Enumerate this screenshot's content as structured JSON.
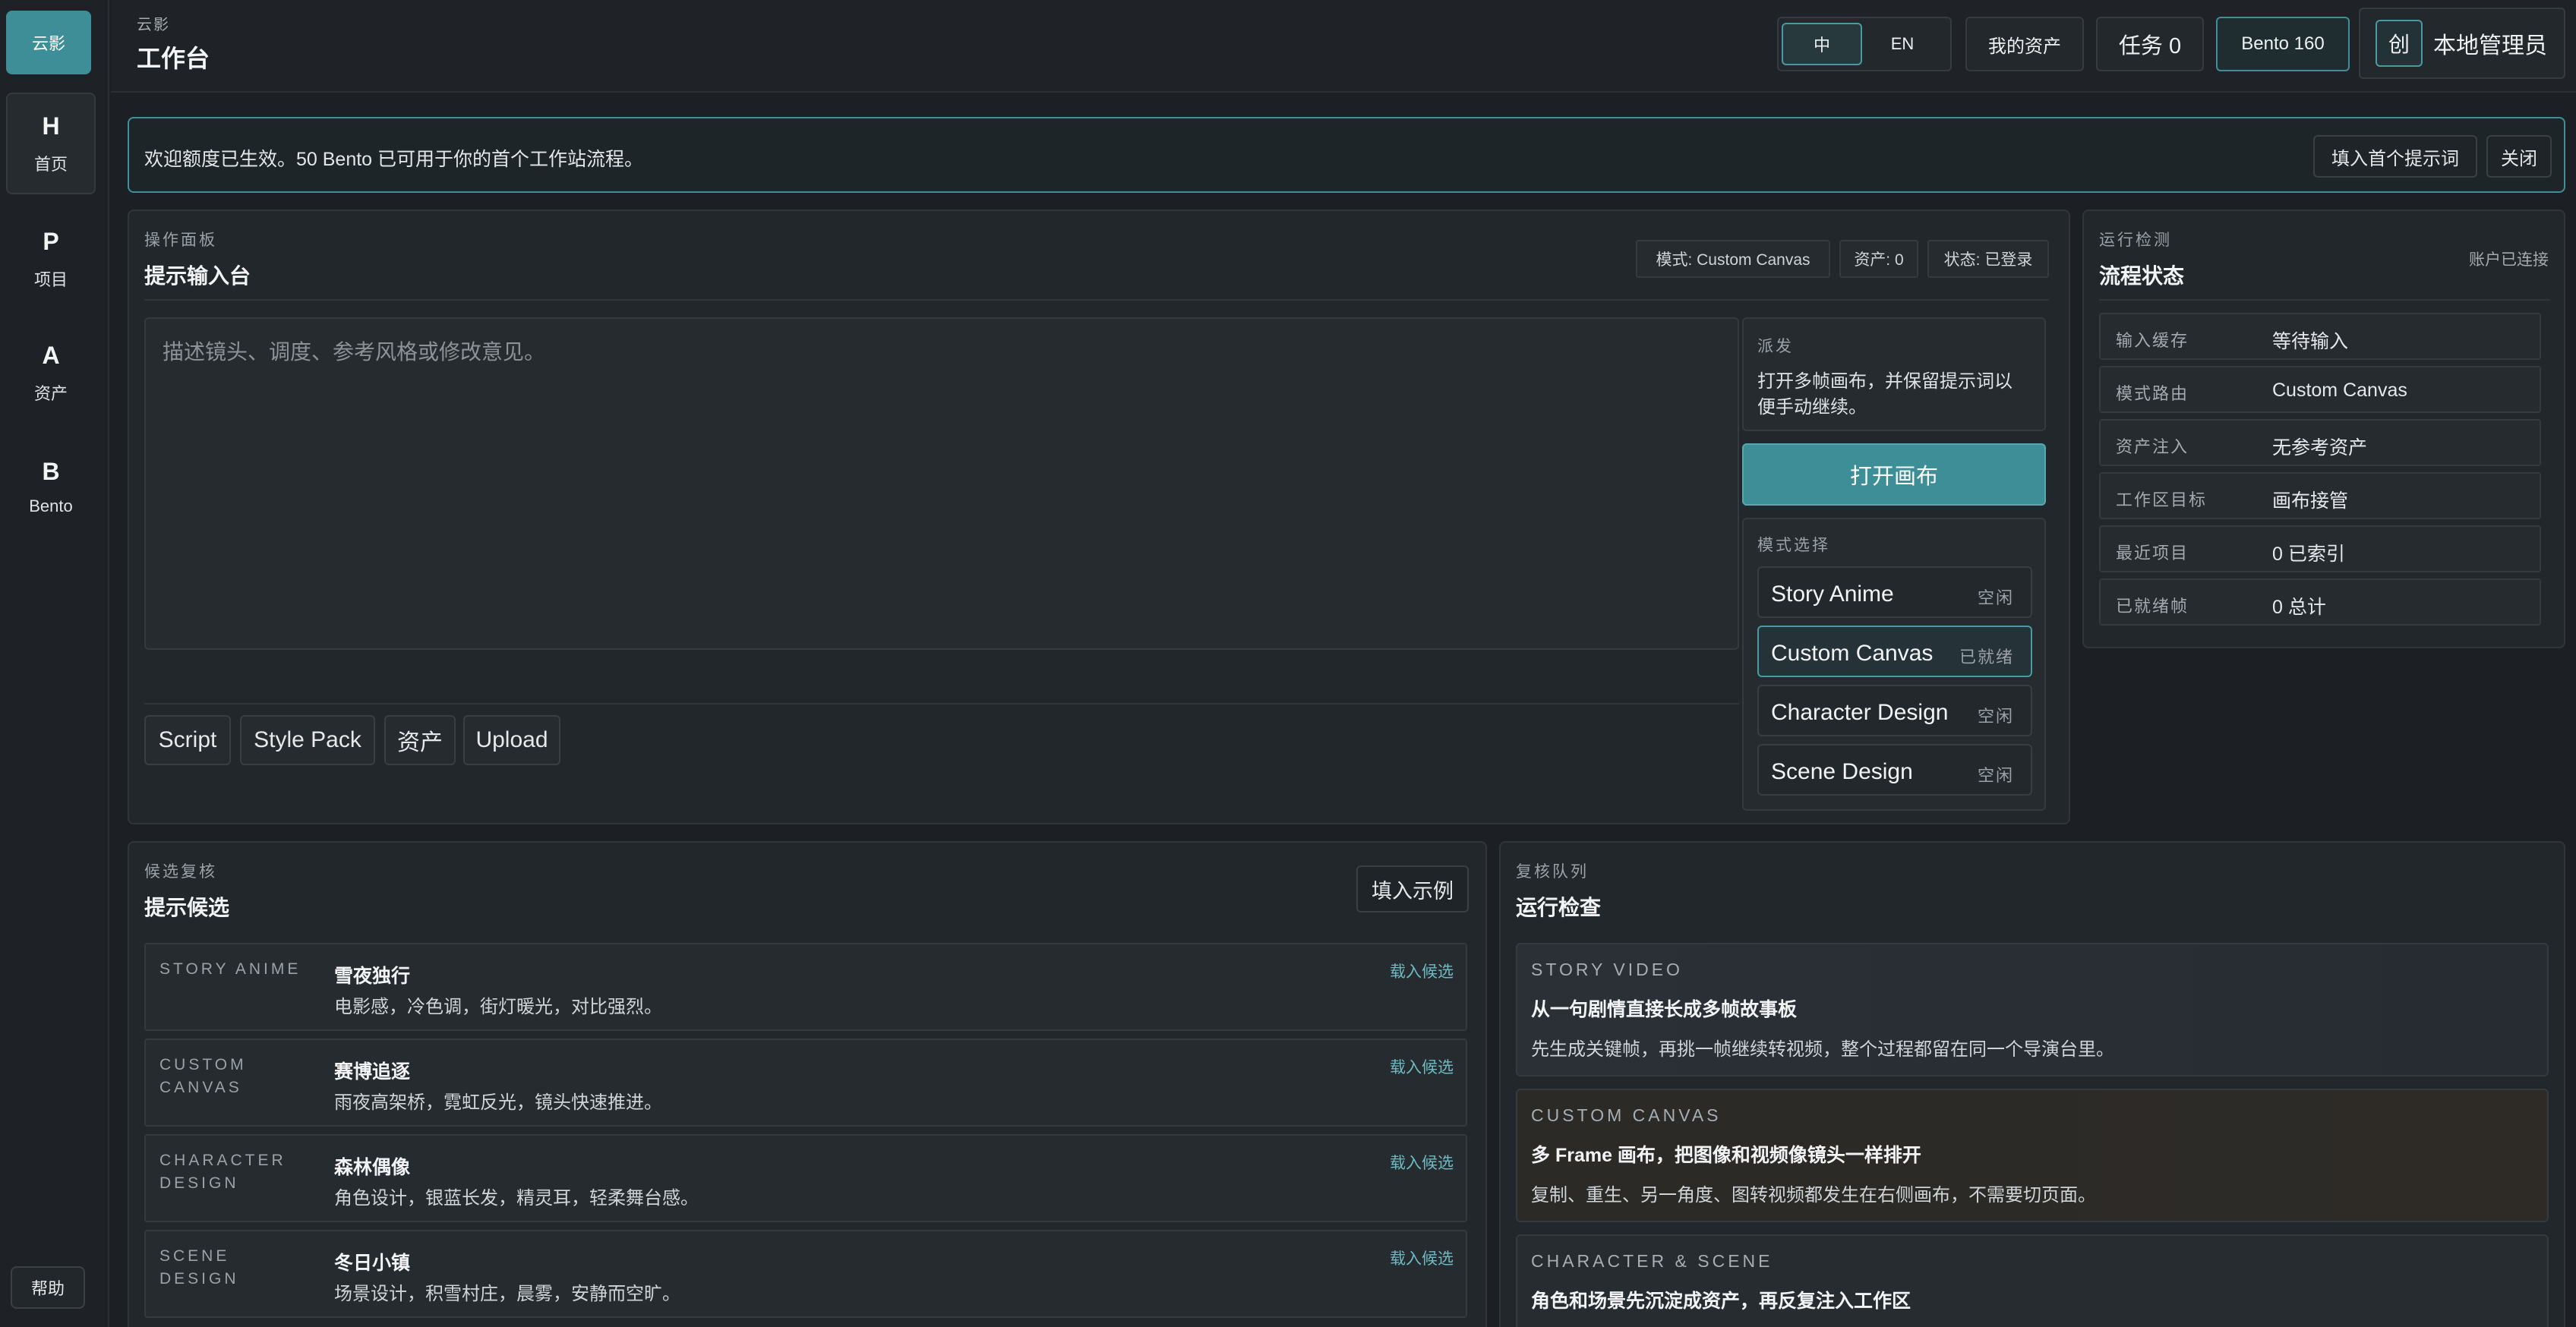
{
  "sidebar": {
    "logo": "云影",
    "items": [
      {
        "letter": "H",
        "label": "首页"
      },
      {
        "letter": "P",
        "label": "项目"
      },
      {
        "letter": "A",
        "label": "资产"
      },
      {
        "letter": "B",
        "label": "Bento"
      }
    ],
    "help": "帮助"
  },
  "header": {
    "brand": "云影",
    "title": "工作台",
    "lang": {
      "zh": "中",
      "en": "EN"
    },
    "my_assets": "我的资产",
    "tasks": "任务 0",
    "bento": "Bento 160",
    "avatar_glyph": "创",
    "user": "本地管理员"
  },
  "notice": {
    "text": "欢迎额度已生效。50 Bento 已可用于你的首个工作站流程。",
    "fill_button": "填入首个提示词",
    "close_button": "关闭"
  },
  "prompt_panel": {
    "eyebrow": "操作面板",
    "title": "提示输入台",
    "chips": [
      "模式: Custom Canvas",
      "资产: 0",
      "状态: 已登录"
    ],
    "placeholder": "描述镜头、调度、参考风格或修改意见。",
    "tools": [
      "Script",
      "Style Pack",
      "资产",
      "Upload"
    ],
    "dispatch": {
      "label": "派发",
      "text_line1": "打开多帧画布，并保留提示词以",
      "text_line2": "便手动继续。"
    },
    "open_button": "打开画布",
    "mode_label": "模式选择",
    "modes": [
      {
        "name": "Story Anime",
        "status": "空闲"
      },
      {
        "name": "Custom Canvas",
        "status": "已就绪"
      },
      {
        "name": "Character Design",
        "status": "空闲"
      },
      {
        "name": "Scene Design",
        "status": "空闲"
      }
    ]
  },
  "status_panel": {
    "eyebrow": "运行检测",
    "title": "流程状态",
    "account": "账户已连接",
    "rows": [
      {
        "key": "输入缓存",
        "value": "等待输入"
      },
      {
        "key": "模式路由",
        "value": "Custom Canvas"
      },
      {
        "key": "资产注入",
        "value": "无参考资产"
      },
      {
        "key": "工作区目标",
        "value": "画布接管"
      },
      {
        "key": "最近项目",
        "value": "0 已索引"
      },
      {
        "key": "已就绪帧",
        "value": "0 总计"
      }
    ]
  },
  "candidates_panel": {
    "eyebrow": "候选复核",
    "title": "提示候选",
    "fill_example": "填入示例",
    "load_label": "载入候选",
    "items": [
      {
        "cat1": "STORY ANIME",
        "cat2": "",
        "title": "雪夜独行",
        "desc": "电影感，冷色调，街灯暖光，对比强烈。"
      },
      {
        "cat1": "CUSTOM",
        "cat2": "CANVAS",
        "title": "赛博追逐",
        "desc": "雨夜高架桥，霓虹反光，镜头快速推进。"
      },
      {
        "cat1": "CHARACTER",
        "cat2": "DESIGN",
        "title": "森林偶像",
        "desc": "角色设计，银蓝长发，精灵耳，轻柔舞台感。"
      },
      {
        "cat1": "SCENE DESIGN",
        "cat2": "",
        "title": "冬日小镇",
        "desc": "场景设计，积雪村庄，晨雾，安静而空旷。"
      }
    ]
  },
  "review_panel": {
    "eyebrow": "复核队列",
    "title": "运行检查",
    "cards": [
      {
        "eyebrow": "STORY VIDEO",
        "title": "从一句剧情直接长成多帧故事板",
        "desc": "先生成关键帧，再挑一帧继续转视频，整个过程都留在同一个导演台里。"
      },
      {
        "eyebrow": "CUSTOM CANVAS",
        "title": "多 Frame 画布，把图像和视频像镜头一样排开",
        "desc": "复制、重生、另一角度、图转视频都发生在右侧画布，不需要切页面。"
      },
      {
        "eyebrow": "CHARACTER & SCENE",
        "title": "角色和场景先沉淀成资产，再反复注入工作区",
        "desc": ""
      }
    ]
  },
  "colors": {
    "accent": "#3d8e97",
    "background": "#1c2024",
    "panel": "#22272b"
  }
}
